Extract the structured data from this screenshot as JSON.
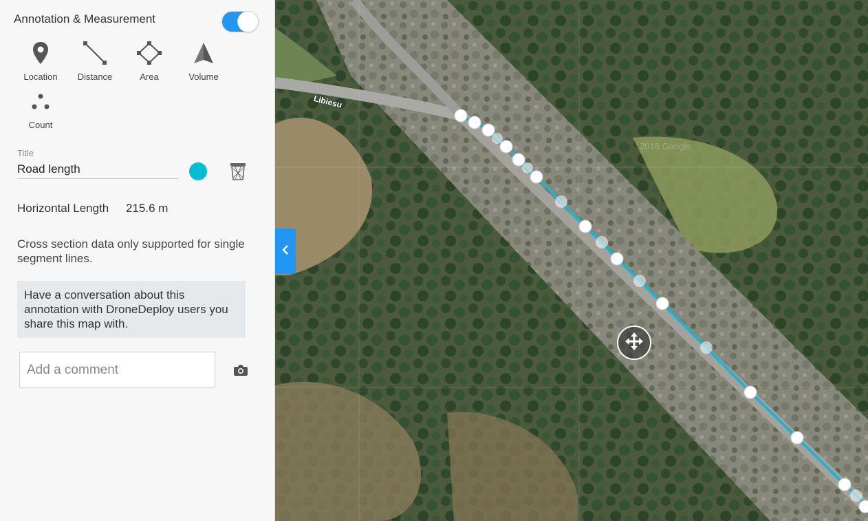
{
  "panel": {
    "title": "Annotation & Measurement",
    "toggle_on": true
  },
  "tools": [
    {
      "label": "Location",
      "icon": "location-pin-icon"
    },
    {
      "label": "Distance",
      "icon": "distance-line-icon"
    },
    {
      "label": "Area",
      "icon": "area-polygon-icon"
    },
    {
      "label": "Volume",
      "icon": "volume-pyramid-icon"
    },
    {
      "label": "Count",
      "icon": "count-dots-icon"
    }
  ],
  "annotation": {
    "field_label": "Title",
    "title_value": "Road length",
    "color": "#00bcd4"
  },
  "measurement": {
    "label": "Horizontal Length",
    "value": "215.6 m"
  },
  "cross_section_note": "Cross section data only supported for single segment lines.",
  "conversation_note": "Have a conversation about this annotation with DroneDeploy users you share this map with.",
  "comment": {
    "placeholder": "Add a comment"
  },
  "map": {
    "road_label": "Libiesu",
    "watermark": "2018 Google",
    "line_color": "#1fb3d1",
    "accent": "#2196f3"
  }
}
